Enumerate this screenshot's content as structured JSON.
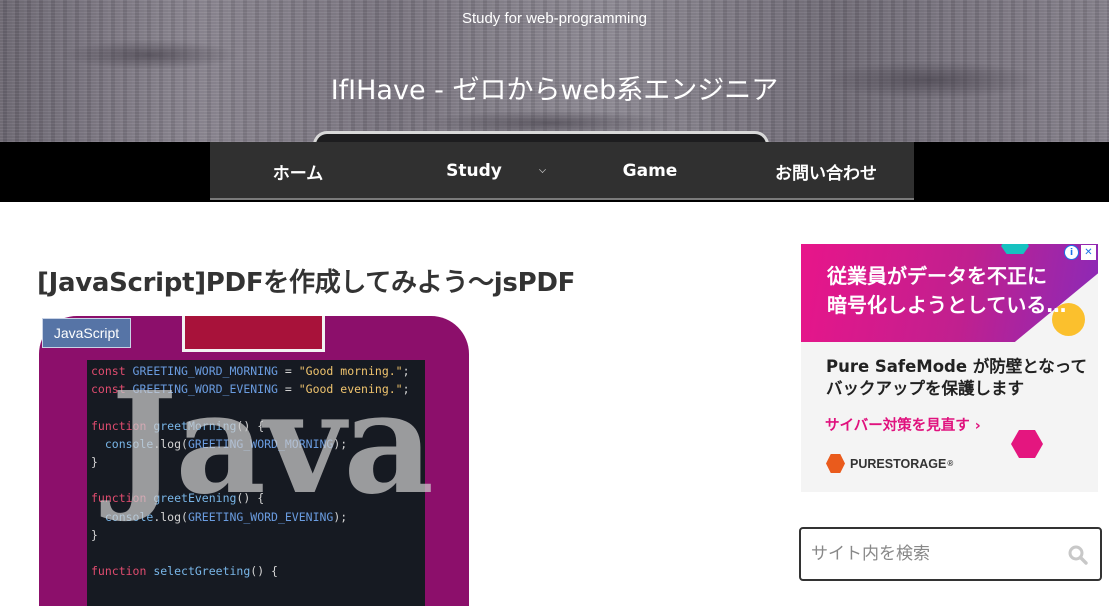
{
  "header": {
    "tagline": "Study for web-programming",
    "site_title": "IfIHave - ゼロからweb系エンジニア"
  },
  "nav": {
    "items": [
      {
        "label": "ホーム"
      },
      {
        "label": "Study"
      },
      {
        "label": "Game"
      },
      {
        "label": "お問い合わせ"
      }
    ]
  },
  "post": {
    "title": "[JavaScript]PDFを作成してみよう〜jsPDF",
    "category": "JavaScript",
    "thumbnail": {
      "big_word": "Java",
      "code_lines": [
        {
          "kw": "const",
          "name": " GREETING_WORD_MORNING",
          "rest": " = ",
          "str": "\"Good morning.\"",
          "end": ";"
        },
        {
          "kw": "const",
          "name": " GREETING_WORD_EVENING",
          "rest": " = ",
          "str": "\"Good evening.\"",
          "end": ";"
        }
      ]
    }
  },
  "ad": {
    "headline_1": "従業員がデータを不正に",
    "headline_2": "暗号化しようとしている…",
    "sub_1": "Pure SafeMode が防壁となって",
    "sub_2": "バックアップを保護します",
    "cta": "サイバー対策を見直す ›",
    "brand": "PURESTORAGE",
    "brand_mark": "®",
    "adchoices_i": "i",
    "adchoices_x": "✕",
    "colors": {
      "magenta": "#e8158a",
      "purple": "#8a2ab8",
      "yellow": "#fbc02d",
      "teal": "#16c2c0",
      "orange": "#ea5b1c"
    }
  },
  "search": {
    "placeholder": "サイト内を検索",
    "icon": "search-icon"
  },
  "colors": {
    "navbar": "#000000",
    "nav_inner": "#303030",
    "category_badge": "#5674a6",
    "thumb_bg": "#8c0f6b"
  }
}
